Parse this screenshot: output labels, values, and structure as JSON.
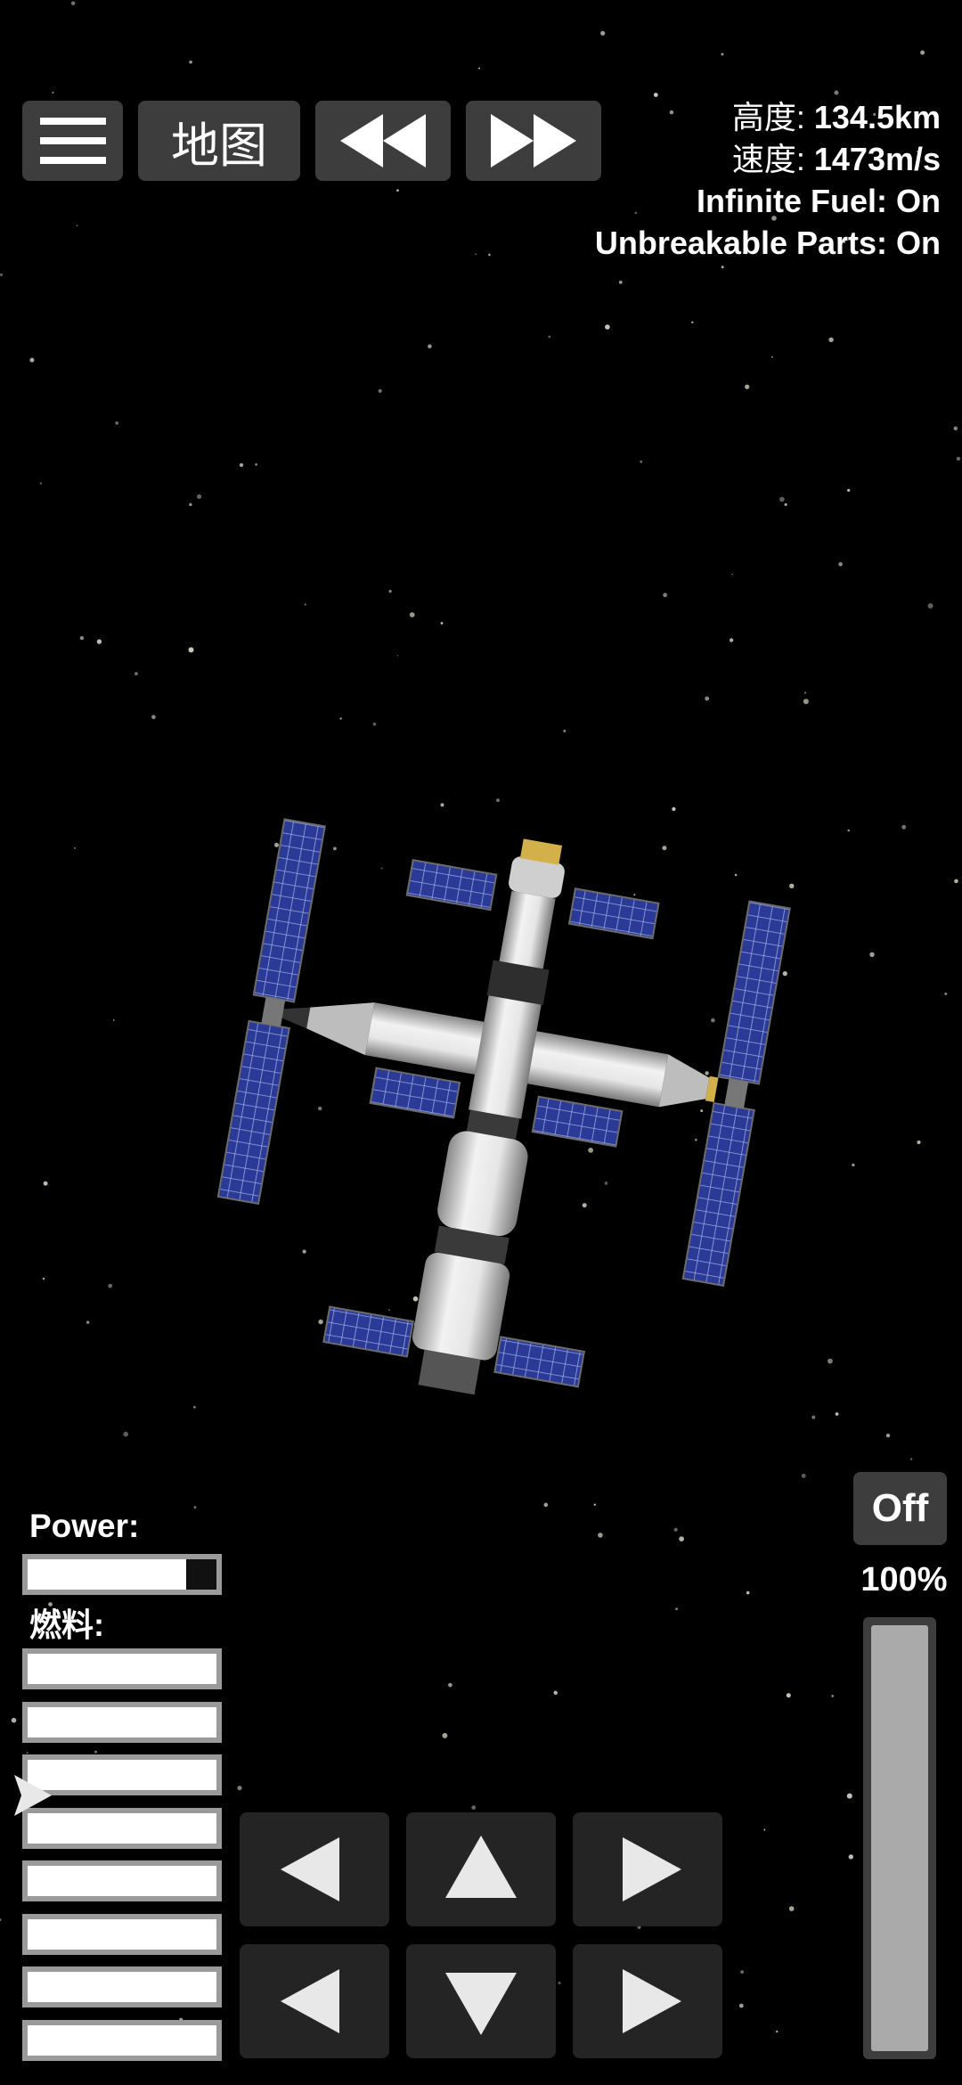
{
  "toolbar": {
    "menu_icon": "hamburger-menu-icon",
    "map_label": "地图",
    "rewind_icon": "rewind-icon",
    "fast_forward_icon": "fast-forward-icon"
  },
  "hud": {
    "altitude_label": "高度:",
    "altitude_value": "134.5km",
    "speed_label": "速度:",
    "speed_value": "1473m/s",
    "infinite_fuel": "Infinite Fuel: On",
    "unbreakable_parts": "Unbreakable Parts: On"
  },
  "resources": {
    "power_label": "Power:",
    "power_level": 0.84,
    "fuel_label": "燃料:",
    "fuel_tanks": [
      1,
      1,
      1,
      1,
      1,
      1,
      1,
      1
    ]
  },
  "controls": {
    "rotate_left_icon": "rotate-left-icon",
    "up_icon": "up-arrow-icon",
    "rotate_right_icon": "rotate-right-icon",
    "left_icon": "left-arrow-icon",
    "down_icon": "down-arrow-icon",
    "right_icon": "right-arrow-icon"
  },
  "throttle": {
    "engine_toggle_label": "Off",
    "percent_label": "100%",
    "level": 1.0
  },
  "colors": {
    "background": "#000000",
    "button": "#3d3d3d",
    "control_pad": "#242424",
    "solar_panel": "#2f3f9e",
    "module_body": "#d9d9d9"
  }
}
